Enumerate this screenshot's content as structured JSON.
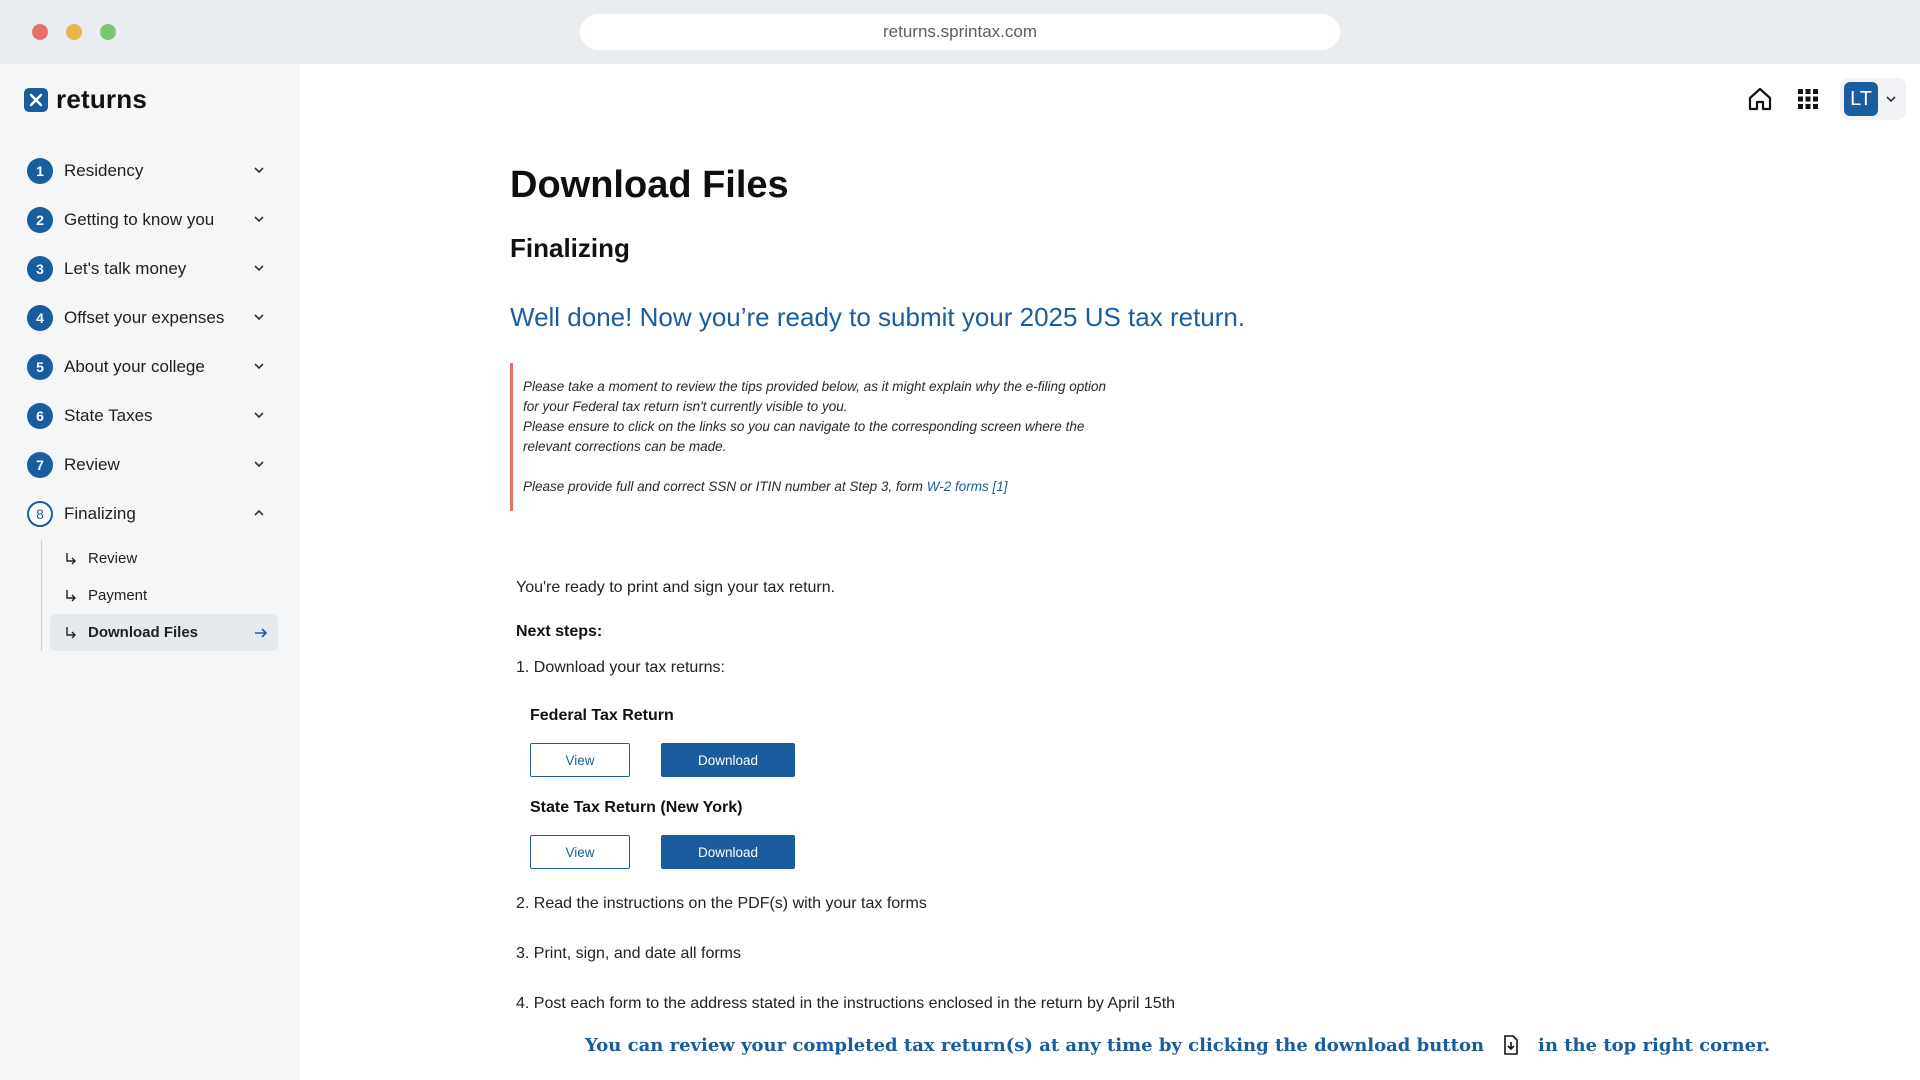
{
  "browser": {
    "url": "returns.sprintax.com"
  },
  "sidebar": {
    "logo_text": "returns",
    "steps": [
      {
        "num": "1",
        "label": "Residency"
      },
      {
        "num": "2",
        "label": "Getting to know you"
      },
      {
        "num": "3",
        "label": "Let's talk money"
      },
      {
        "num": "4",
        "label": "Offset your expenses"
      },
      {
        "num": "5",
        "label": "About your college"
      },
      {
        "num": "6",
        "label": "State Taxes"
      },
      {
        "num": "7",
        "label": "Review"
      },
      {
        "num": "8",
        "label": "Finalizing"
      }
    ],
    "substeps": [
      {
        "label": "Review"
      },
      {
        "label": "Payment"
      },
      {
        "label": "Download Files"
      }
    ]
  },
  "header": {
    "avatar_initials": "LT"
  },
  "main": {
    "title": "Download Files",
    "subtitle": "Finalizing",
    "welldone": "Well done! Now you’re ready to submit your 2025 US tax return.",
    "notice": {
      "line1": "Please take a moment to review the tips provided below, as it might explain why the e-filing option",
      "line2": "for your Federal tax return isn't currently visible to you.",
      "line3": "Please ensure to click on the links so you can navigate to the corresponding screen where the",
      "line4": "relevant corrections can be made.",
      "line5": "Please provide full and correct SSN or ITIN number at Step 3, form",
      "link": "W-2 forms [1]"
    },
    "ready_text": "You're ready to print and sign your tax return.",
    "next_steps_label": "Next steps:",
    "step1": "1. Download your tax returns:",
    "federal_title": "Federal Tax Return",
    "state_title": "State Tax Return (New York)",
    "view_label": "View",
    "download_label": "Download",
    "step2": "2. Read the instructions on the PDF(s) with your tax forms",
    "step3": "3. Print, sign, and date all forms",
    "step4": "4. Post each form to the address stated in the instructions enclosed in the return by April 15th",
    "footnote_before": "You can review your completed tax return(s) at any time by clicking the download button",
    "footnote_after": "in the top right corner."
  },
  "colors": {
    "accent": "#1a5d9e",
    "notice_border": "#e0726c"
  }
}
